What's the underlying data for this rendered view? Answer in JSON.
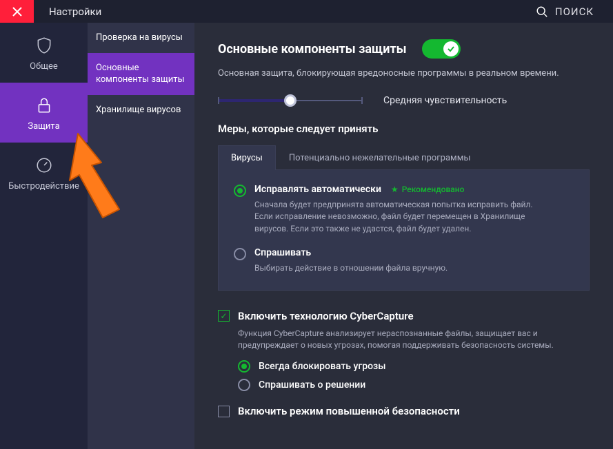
{
  "topbar": {
    "title": "Настройки",
    "search_label": "ПОИСК"
  },
  "sidebar": {
    "items": [
      {
        "label": "Общее"
      },
      {
        "label": "Защита"
      },
      {
        "label": "Быстродействие"
      }
    ]
  },
  "submenu": {
    "items": [
      {
        "label": "Проверка на вирусы"
      },
      {
        "label": "Основные компоненты защиты"
      },
      {
        "label": "Хранилище вирусов"
      }
    ]
  },
  "main": {
    "title": "Основные компоненты защиты",
    "description": "Основная защита, блокирующая вредоносные программы в реальном времени.",
    "slider_label": "Средняя чувствительность",
    "measures_title": "Меры, которые следует принять",
    "tabs": [
      {
        "label": "Вирусы"
      },
      {
        "label": "Потенциально нежелательные программы"
      }
    ],
    "radios": [
      {
        "title": "Исправлять автоматически",
        "recommended": "Рекомендовано",
        "desc": "Сначала будет предпринята автоматическая попытка исправить файл. Если исправление невозможно, файл будет перемещен в Хранилище вирусов. Если это также не удастся, файл будет удален."
      },
      {
        "title": "Спрашивать",
        "desc": "Выбирать действие в отношении файла вручную."
      }
    ],
    "cyber": {
      "label": "Включить технологию CyberCapture",
      "desc": "Функция CyberCapture анализирует нераспознанные файлы, защищает вас и предупреждает о новых угрозах, помогая поддерживать безопасность системы.",
      "opt1": "Всегда блокировать угрозы",
      "opt2": "Спрашивать о решении"
    },
    "hardened": {
      "label": "Включить режим повышенной безопасности"
    }
  }
}
